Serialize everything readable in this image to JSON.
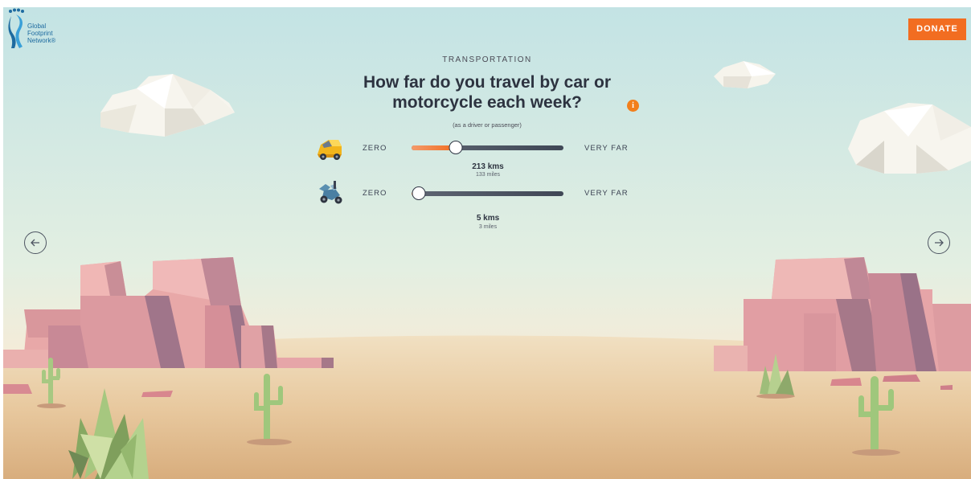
{
  "brand": {
    "line1": "Global",
    "line2": "Footprint",
    "line3": "Network®"
  },
  "header": {
    "donate_label": "DONATE"
  },
  "question": {
    "category": "TRANSPORTATION",
    "title": "How far do you travel by car or motorcycle each week?",
    "note": "(as a driver or passenger)"
  },
  "sliders": [
    {
      "icon": "car-icon",
      "min_label": "ZERO",
      "max_label": "VERY FAR",
      "value_km": "213 kms",
      "value_miles": "133 miles",
      "fraction": 0.29
    },
    {
      "icon": "scooter-icon",
      "min_label": "ZERO",
      "max_label": "VERY FAR",
      "value_km": "5 kms",
      "value_miles": "3 miles",
      "fraction": 0.05
    }
  ],
  "colors": {
    "accent": "#f26d21",
    "sky": "#cfe8e6",
    "sand": "#e6c89d",
    "rock": "#e1a0a4",
    "cactus": "#9fc77c"
  }
}
